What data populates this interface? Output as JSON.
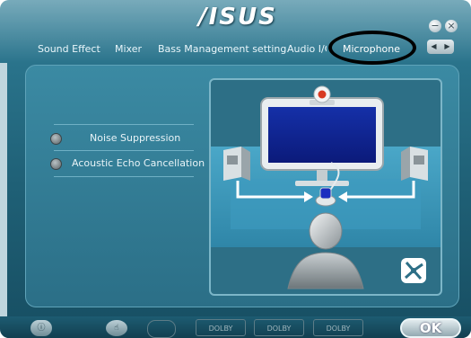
{
  "header": {
    "logo": "/ISUS",
    "minimize_glyph": "−",
    "close_glyph": "×"
  },
  "tabs": [
    {
      "label": "Sound Effect",
      "active": false
    },
    {
      "label": "Mixer",
      "active": false
    },
    {
      "label": "Bass Management setting",
      "active": false
    },
    {
      "label": "Audio I/O",
      "active": false
    },
    {
      "label": "Microphone",
      "active": true
    }
  ],
  "tab_nav": {
    "prev": "◀",
    "next": "▶"
  },
  "options": [
    {
      "label": "Noise Suppression",
      "selected": false
    },
    {
      "label": "Acoustic Echo Cancellation",
      "selected": false
    }
  ],
  "footer": {
    "info_icon": "info-icon",
    "dolby_labels": [
      "DOLBY",
      "DOLBY",
      "DOLBY"
    ],
    "ok_label": "OK"
  },
  "colors": {
    "frame": "#2a7490",
    "panel": "#3585a0",
    "highlight_ellipse": "#000000"
  }
}
